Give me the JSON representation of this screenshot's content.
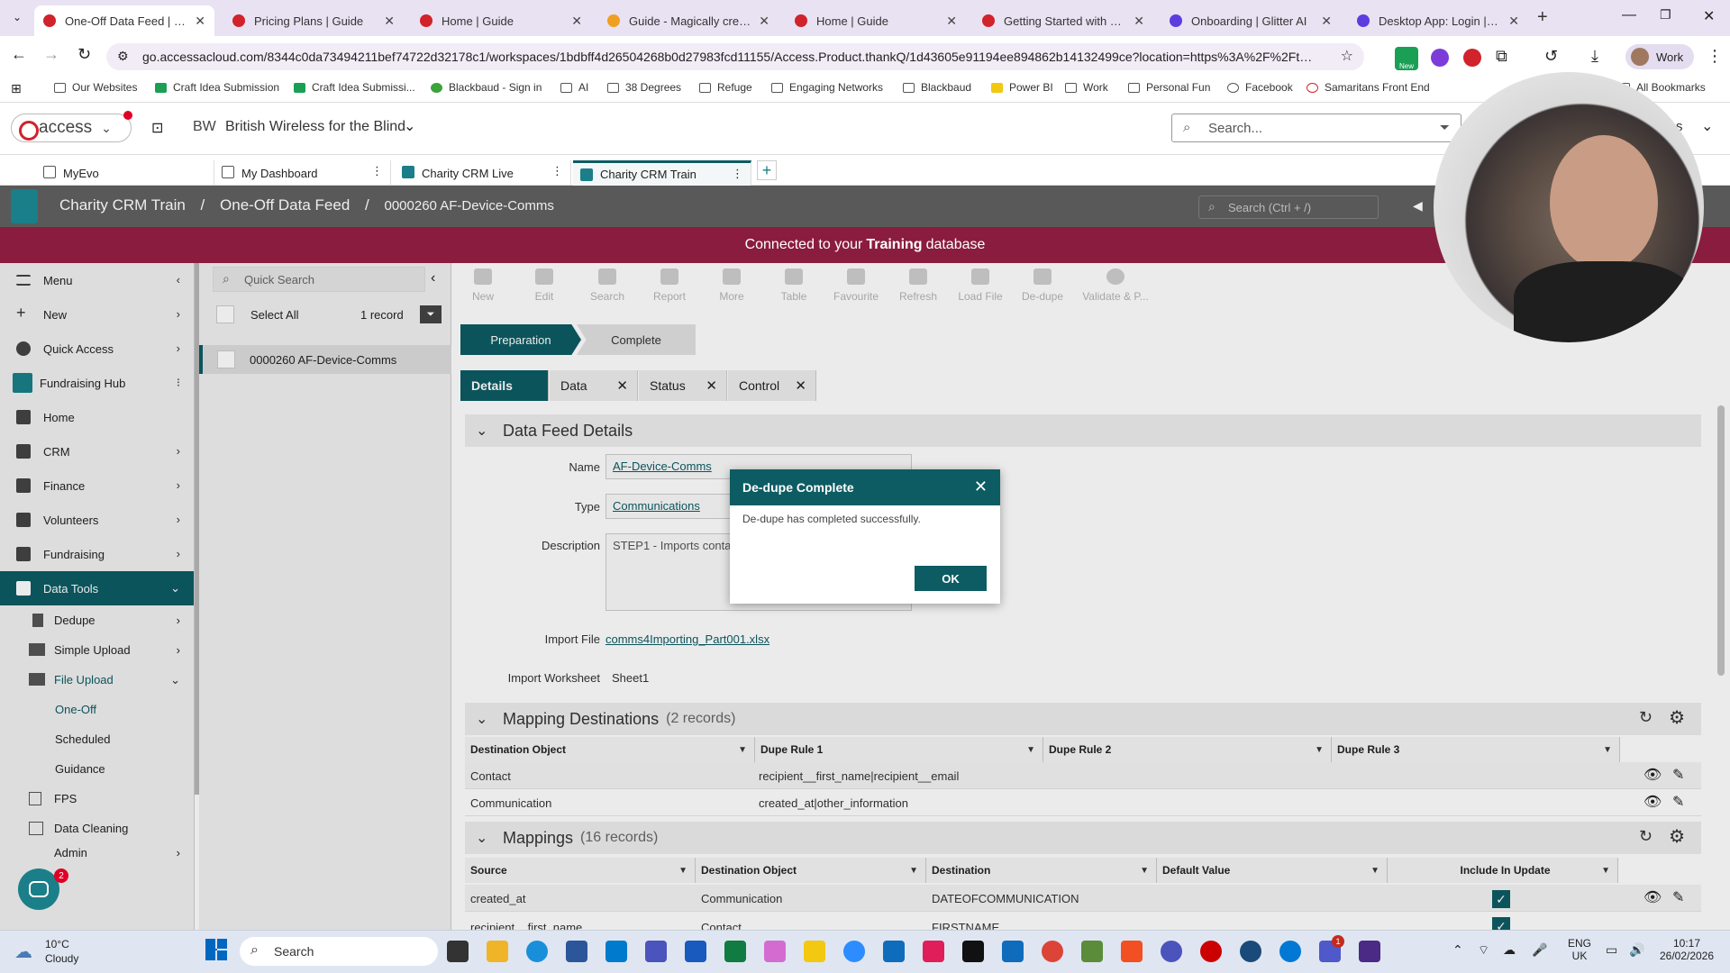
{
  "browser": {
    "tabs": [
      {
        "title": "One-Off Data Feed | Char",
        "active": true
      },
      {
        "title": "Pricing Plans | Guide"
      },
      {
        "title": "Home | Guide"
      },
      {
        "title": "Guide - Magically create"
      },
      {
        "title": "Home | Guide"
      },
      {
        "title": "Getting Started with Capt"
      },
      {
        "title": "Onboarding | Glitter AI"
      },
      {
        "title": "Desktop App: Login | Glit"
      }
    ],
    "url": "go.accessacloud.com/8344c0da73494211bef74722d32178c1/workspaces/1bdbff4d26504268b0d27983fcd11155/Access.Product.thankQ/1d43605e91194ee894862b14132499ce?location=https%3A%2F%2Fthankqbli...",
    "profile": "Work",
    "bookmarks": [
      "Our Websites",
      "Craft Idea Submission",
      "Craft Idea Submissi...",
      "Blackbaud - Sign in",
      "AI",
      "38 Degrees",
      "Refuge",
      "Engaging Networks",
      "Blackbaud",
      "Power BI",
      "Work",
      "Personal Fun",
      "Facebook",
      "Samaritans Front End"
    ],
    "all_bookmarks": "All Bookmarks",
    "new_badge": "New"
  },
  "app": {
    "logo_text": "access",
    "org_initials": "BW",
    "org_name": "British Wireless for the Blind",
    "search_placeholder": "Search...",
    "header_right_text": "s",
    "tabs": [
      "MyEvo",
      "My Dashboard",
      "Charity CRM Live",
      "Charity CRM Train"
    ],
    "breadcrumb": [
      "Charity CRM Train",
      "One-Off Data Feed",
      "0000260 AF-Device-Comms"
    ],
    "crumb_search": "Search (Ctrl + /)",
    "banner_prefix": "Connected to your ",
    "banner_bold": "Training",
    "banner_suffix": " database"
  },
  "menu": {
    "title": "Menu",
    "items": [
      "New",
      "Quick Access",
      "Fundraising Hub",
      "Home",
      "CRM",
      "Finance",
      "Volunteers",
      "Fundraising",
      "Data Tools"
    ],
    "data_tools_sub": [
      "Dedupe",
      "Simple Upload",
      "File Upload"
    ],
    "file_upload_sub": [
      "One-Off",
      "Scheduled",
      "Guidance"
    ],
    "more_items": [
      "FPS",
      "Data Cleaning",
      "Admin"
    ]
  },
  "list": {
    "quick_search": "Quick Search",
    "select_all": "Select All",
    "record_count": "1 record",
    "rows": [
      "0000260 AF-Device-Comms"
    ]
  },
  "toolbar": [
    "New",
    "Edit",
    "Search",
    "Report",
    "More",
    "Table",
    "Favourite",
    "Refresh",
    "Load File",
    "De-dupe",
    "Validate & P..."
  ],
  "workflow": [
    "Preparation",
    "Complete"
  ],
  "detail_tabs": [
    "Details",
    "Data",
    "Status",
    "Control"
  ],
  "details": {
    "section_title": "Data Feed Details",
    "name_label": "Name",
    "name_value": "AF-Device-Comms",
    "type_label": "Type",
    "type_value": "Communications",
    "desc_label": "Description",
    "desc_value": "STEP1 - Imports contac",
    "file_label": "Import File",
    "file_value": "comms4Importing_Part001.xlsx",
    "worksheet_label": "Import Worksheet",
    "worksheet_value": "Sheet1"
  },
  "mapping_destinations": {
    "title": "Mapping Destinations",
    "count": "(2 records)",
    "columns": [
      "Destination Object",
      "Dupe Rule 1",
      "Dupe Rule 2",
      "Dupe Rule 3"
    ],
    "rows": [
      [
        "Contact",
        "recipient__first_name|recipient__email",
        "",
        ""
      ],
      [
        "Communication",
        "created_at|other_information",
        "",
        ""
      ]
    ]
  },
  "mappings": {
    "title": "Mappings",
    "count": "(16 records)",
    "columns": [
      "Source",
      "Destination Object",
      "Destination",
      "Default Value",
      "Include In Update"
    ],
    "rows": [
      [
        "created_at",
        "Communication",
        "DATEOFCOMMUNICATION",
        ""
      ],
      [
        "recipient__first_name",
        "Contact",
        "FIRSTNAME",
        ""
      ]
    ]
  },
  "dialog": {
    "title": "De-dupe Complete",
    "message": "De-dupe has completed successfully.",
    "ok": "OK"
  },
  "chat_badge": "2",
  "taskbar": {
    "weather_temp": "10°C",
    "weather_desc": "Cloudy",
    "search": "Search",
    "lang1": "ENG",
    "lang2": "UK",
    "time": "10:17",
    "date": "26/02/2026",
    "teams_badge": "1"
  }
}
